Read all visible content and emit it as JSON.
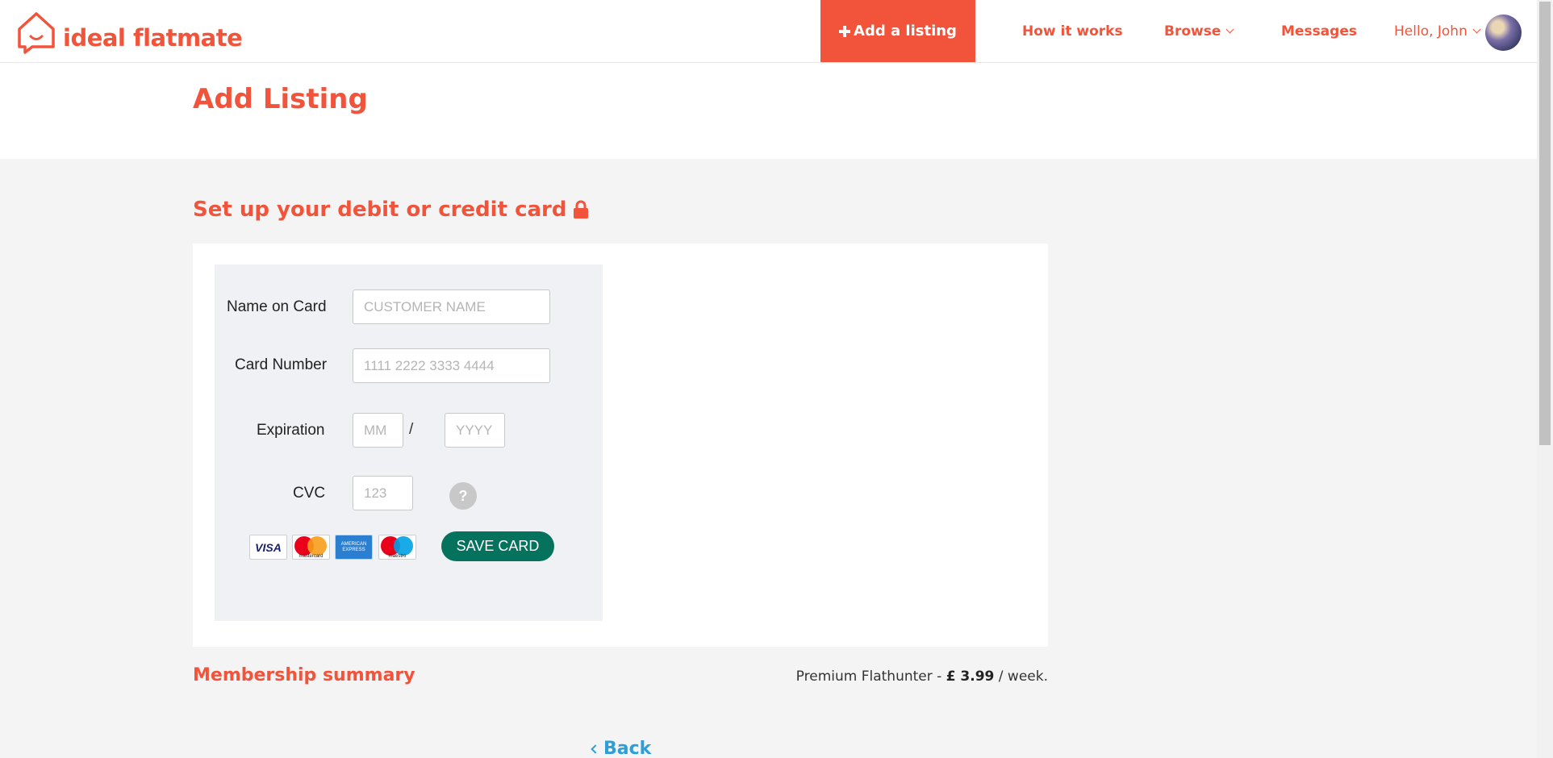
{
  "header": {
    "logo_text": "ideal flatmate",
    "add_listing_label": "Add a listing",
    "nav": {
      "how_it_works": "How it works",
      "browse": "Browse",
      "messages": "Messages",
      "user_greeting": "Hello, John"
    }
  },
  "page": {
    "title": "Add Listing",
    "section_title": "Set up your debit or credit card"
  },
  "form": {
    "name_label": "Name on Card",
    "name_placeholder": "CUSTOMER NAME",
    "number_label": "Card Number",
    "number_placeholder": "1111 2222 3333 4444",
    "expiration_label": "Expiration",
    "month_placeholder": "MM",
    "separator": "/",
    "year_placeholder": "YYYY",
    "cvc_label": "CVC",
    "cvc_placeholder": "123",
    "help_symbol": "?",
    "card_logos": {
      "visa": "VISA",
      "mastercard": "mastercard",
      "amex": "AMERICAN EXPRESS",
      "maestro": "maestro"
    },
    "save_label": "SAVE CARD"
  },
  "membership": {
    "title": "Membership summary",
    "plan": "Premium Flathunter - ",
    "price": "£ 3.99",
    "period": " / week."
  },
  "footer": {
    "back_label": "Back"
  },
  "colors": {
    "brand": "#f1543a",
    "save_button": "#05725e",
    "link": "#2d9fd8"
  }
}
